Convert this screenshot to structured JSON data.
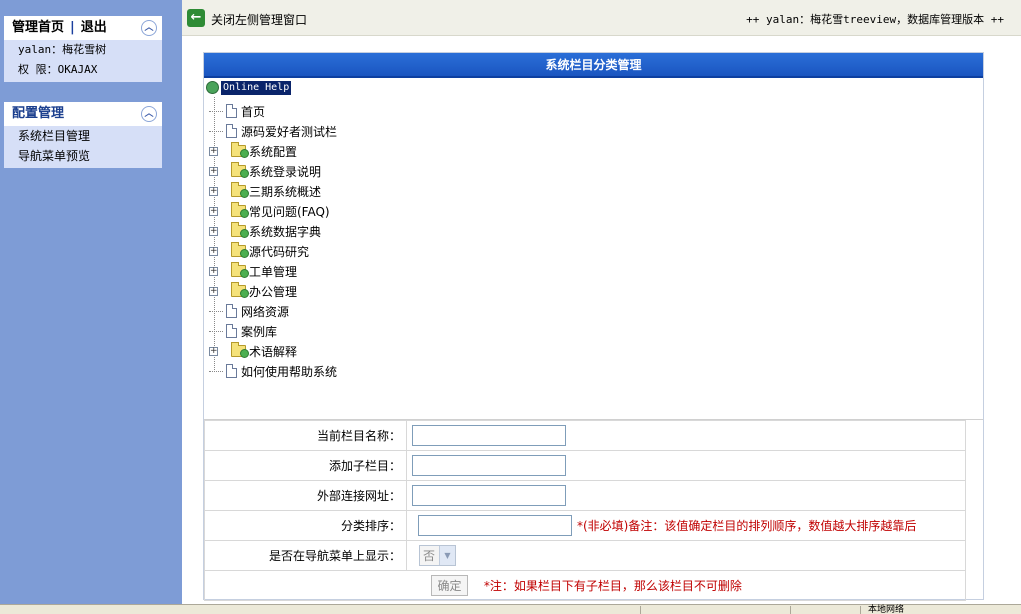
{
  "sidebar": {
    "user_panel": {
      "home_link": "管理首页",
      "separator": "|",
      "logout_link": "退出",
      "username_line": "yalan：梅花雪树",
      "permission_line": "权 限：OKAJAX"
    },
    "config_panel": {
      "title": "配置管理",
      "items": [
        {
          "label": "系统栏目管理"
        },
        {
          "label": "导航菜单预览"
        }
      ]
    }
  },
  "topbar": {
    "back_glyph": "←",
    "close_left_label": "关闭左侧管理窗口",
    "user_info": "++ yalan：梅花雪treeview，数据库管理版本 ++"
  },
  "main": {
    "title": "系统栏目分类管理",
    "tree": {
      "root_label": "Online Help",
      "nodes": [
        {
          "label": "首页",
          "type": "page"
        },
        {
          "label": "源码爱好者测试栏",
          "type": "page"
        },
        {
          "label": "系统配置",
          "type": "folder"
        },
        {
          "label": "系统登录说明",
          "type": "folder"
        },
        {
          "label": "三期系统概述",
          "type": "folder"
        },
        {
          "label": "常见问题(FAQ)",
          "type": "folder"
        },
        {
          "label": "系统数据字典",
          "type": "folder"
        },
        {
          "label": "源代码研究",
          "type": "folder"
        },
        {
          "label": "工单管理",
          "type": "folder"
        },
        {
          "label": "办公管理",
          "type": "folder"
        },
        {
          "label": "网络资源",
          "type": "page"
        },
        {
          "label": "案例库",
          "type": "page"
        },
        {
          "label": "术语解释",
          "type": "folder"
        },
        {
          "label": "如何使用帮助系统",
          "type": "page"
        }
      ]
    },
    "form": {
      "current_name_label": "当前栏目名称：",
      "current_name_value": "",
      "add_child_label": "添加子栏目：",
      "add_child_value": "",
      "external_url_label": "外部连接网址：",
      "external_url_value": "",
      "sort_label": "分类排序：",
      "sort_value": "",
      "sort_note": "*(非必填)备注：该值确定栏目的排列顺序，数值越大排序越靠后",
      "nav_show_label": "是否在导航菜单上显示：",
      "nav_show_value": "否",
      "submit_label": "确定",
      "delete_note": "*注：如果栏目下有子栏目，那么该栏目不可删除"
    }
  },
  "statusbar": {
    "zone_label": "本地网络"
  }
}
